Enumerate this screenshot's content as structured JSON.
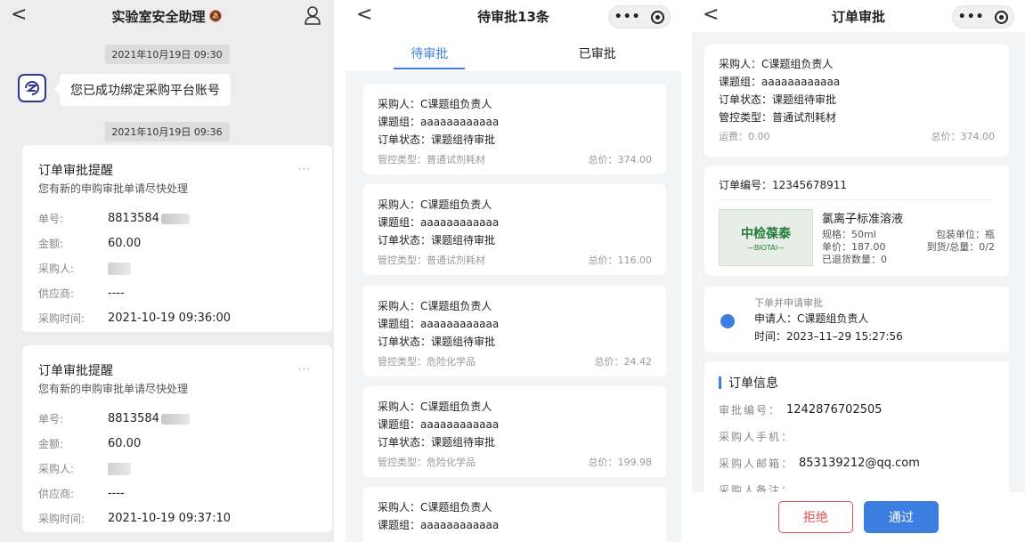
{
  "screen1": {
    "title": "实验室安全助理",
    "time1": "2021年10月19日 09:30",
    "bind_message": "您已成功绑定采购平台账号",
    "time2": "2021年10月19日 09:36",
    "notifications": [
      {
        "title": "订单审批提醒",
        "more": "···",
        "subtitle": "您有新的申购审批单请尽快处理",
        "labels": {
          "no": "单号:",
          "amount": "金额:",
          "buyer": "采购人:",
          "supplier": "供应商:",
          "time": "采购时间:"
        },
        "no": "8813584",
        "amount": "60.00",
        "supplier": "----",
        "time": "2021-10-19 09:36:00"
      },
      {
        "title": "订单审批提醒",
        "more": "···",
        "subtitle": "您有新的申购审批单请尽快处理",
        "labels": {
          "no": "单号:",
          "amount": "金额:",
          "buyer": "采购人:",
          "supplier": "供应商:",
          "time": "采购时间:"
        },
        "no": "8813584",
        "amount": "60.00",
        "supplier": "----",
        "time": "2021-10-19 09:37:10"
      }
    ]
  },
  "screen2": {
    "title": "待审批13条",
    "tabs": [
      "待审批",
      "已审批"
    ],
    "orders": [
      {
        "buyer": "采购人：C课题组负责人",
        "group": "课题组：aaaaaaaaaaaa",
        "status": "订单状态：课题组待审批",
        "control": "管控类型：普通试剂耗材",
        "total": "总价：374.00"
      },
      {
        "buyer": "采购人：C课题组负责人",
        "group": "课题组：aaaaaaaaaaaa",
        "status": "订单状态：课题组待审批",
        "control": "管控类型：普通试剂耗材",
        "total": "总价：116.00"
      },
      {
        "buyer": "采购人：C课题组负责人",
        "group": "课题组：aaaaaaaaaaaa",
        "status": "订单状态：课题组待审批",
        "control": "管控类型：危险化学品",
        "total": "总价：24.42"
      },
      {
        "buyer": "采购人：C课题组负责人",
        "group": "课题组：aaaaaaaaaaaa",
        "status": "订单状态：课题组待审批",
        "control": "管控类型：危险化学品",
        "total": "总价：199.98"
      },
      {
        "buyer": "采购人：C课题组负责人",
        "group": "课题组：aaaaaaaaaaaa"
      }
    ]
  },
  "screen3": {
    "title": "订单审批",
    "summary": {
      "buyer": "采购人：C课题组负责人",
      "group": "课题组：aaaaaaaaaaaa",
      "status": "订单状态：课题组待审批",
      "control": "管控类型：普通试剂耗材",
      "freight": "运费：0.00",
      "total": "总价：374.00"
    },
    "order_no": "订单编号：12345678911",
    "product": {
      "logo_text": "中检葆泰",
      "logo_sub": "—BIOTAI—",
      "name": "氯离子标准溶液",
      "spec": "规格：50ml",
      "unit": "包装单位：瓶",
      "price": "单价：187.00",
      "arrival": "到货/总量：0/2",
      "returned": "已退货数量：0"
    },
    "timeline": {
      "step": "下单并申请审批",
      "applicant": "申请人：C课题组负责人",
      "time": "时间：2023–11–29 15:27:56"
    },
    "info": {
      "heading": "订单信息",
      "approval_label": "审批编号：",
      "approval_no": "1242876702505",
      "phone_label": "采购人手机：",
      "email_label": "采购人邮箱：",
      "email": "853139212@qq.com",
      "remark_label": "采购人备注："
    },
    "actions": {
      "reject": "拒绝",
      "pass": "通过"
    }
  }
}
